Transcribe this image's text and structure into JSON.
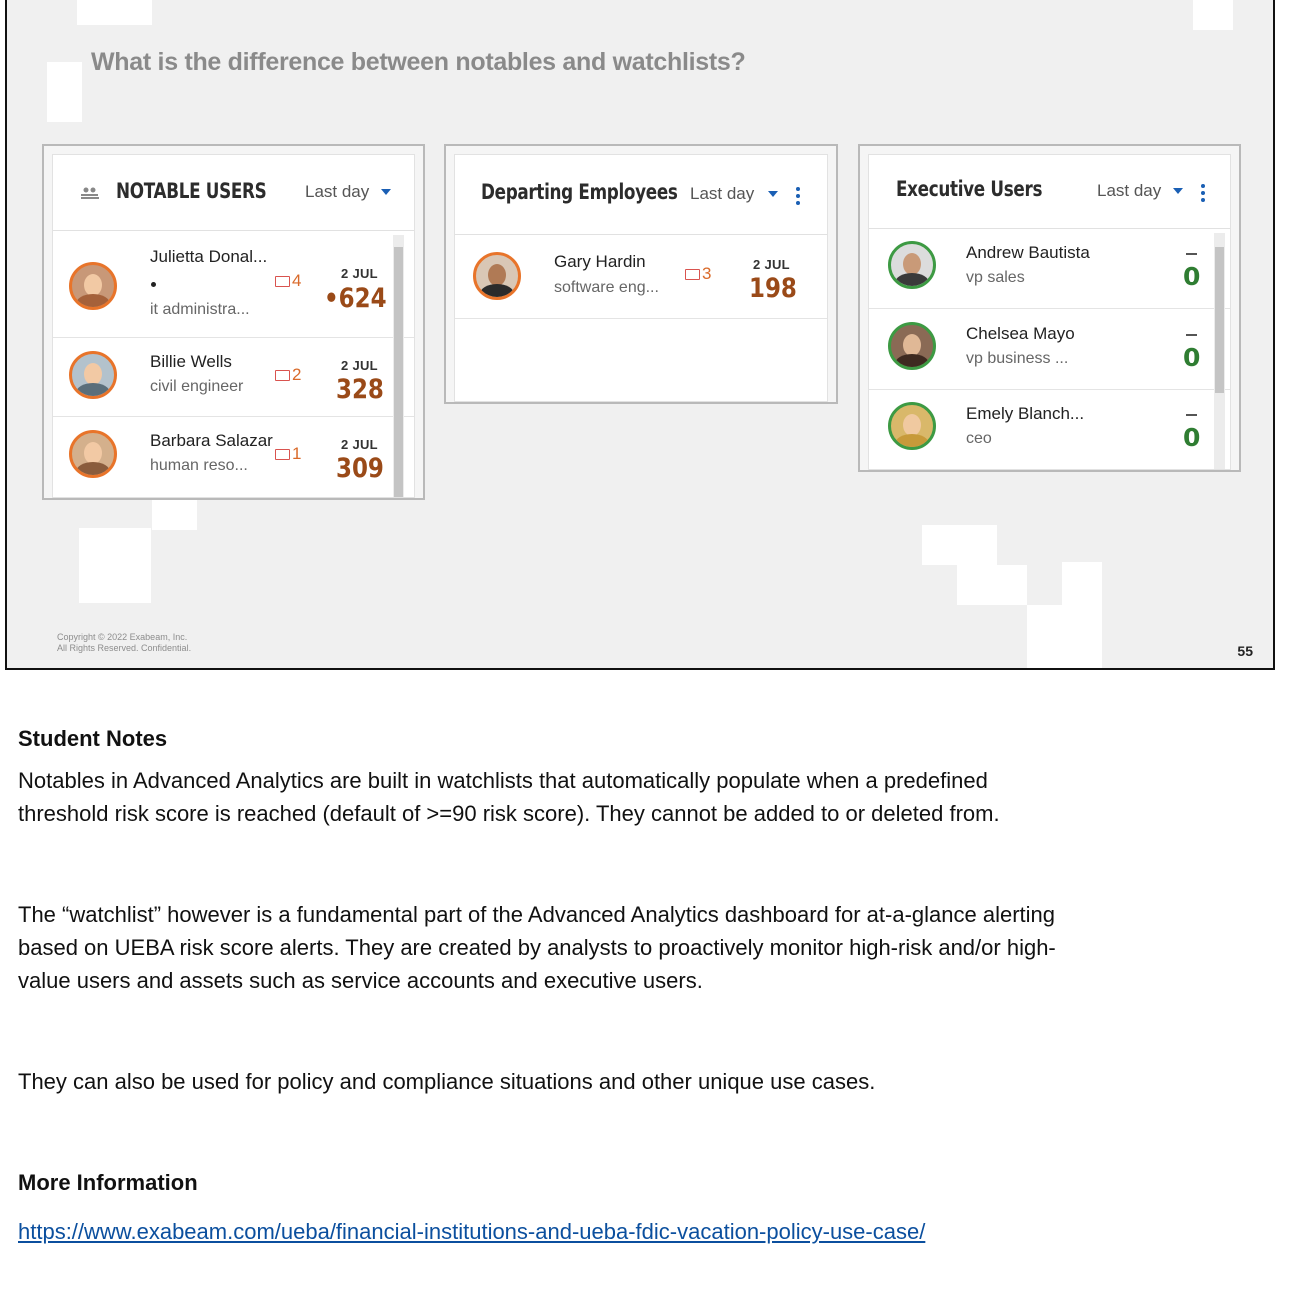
{
  "slide": {
    "title": "What is the difference between notables and watchlists?",
    "copyright_line1": "Copyright © 2022 Exabeam, Inc.",
    "copyright_line2": "All Rights Reserved. Confidential.",
    "page_number": "55"
  },
  "notable_users": {
    "title": "NOTABLE USERS",
    "range": "Last day",
    "rows": [
      {
        "name": "Julietta Donal...",
        "role": "it administra...",
        "count": "4",
        "date": "2 JUL",
        "score": "•624"
      },
      {
        "name": "Billie Wells",
        "role": "civil engineer",
        "count": "2",
        "date": "2 JUL",
        "score": "328"
      },
      {
        "name": "Barbara Salazar",
        "role": "human reso...",
        "count": "1",
        "date": "2 JUL",
        "score": "309"
      }
    ]
  },
  "departing": {
    "title": "Departing Employees",
    "range": "Last day",
    "rows": [
      {
        "name": "Gary Hardin",
        "role": "software eng...",
        "count": "3",
        "date": "2 JUL",
        "score": "198"
      }
    ]
  },
  "executive": {
    "title": "Executive Users",
    "range": "Last day",
    "rows": [
      {
        "name": "Andrew Bautista",
        "role": "vp sales",
        "score": "0"
      },
      {
        "name": "Chelsea Mayo",
        "role": "vp business ...",
        "score": "0"
      },
      {
        "name": "Emely Blanch...",
        "role": "ceo",
        "score": "0"
      }
    ]
  },
  "notes": {
    "heading": "Student Notes",
    "p1_l1": "Notables in Advanced Analytics are built in watchlists that automatically populate when a predefined",
    "p1_l2": "threshold risk score is reached (default of >=90 risk score).  They cannot be added to or deleted from.",
    "p2_l1": "The “watchlist” however is a fundamental part of the Advanced Analytics dashboard for at-a-glance alerting",
    "p2_l2": "based on UEBA risk score alerts. They are created by analysts to proactively monitor high-risk and/or high-",
    "p2_l3": "value users and assets such as service accounts and executive users.",
    "p3": "They can also be used for policy and compliance situations and other unique use cases.",
    "more_heading": "More Information",
    "link": "https://www.exabeam.com/ueba/financial-institutions-and-ueba-fdic-vacation-policy-use-case/"
  },
  "colors": {
    "score_orange": "#9a4a18",
    "score_green": "#2f7d32",
    "avatar_ring_orange": "#e8742a",
    "avatar_ring_green": "#3d9a43",
    "accent_blue": "#1a5fb4",
    "link_blue": "#0b4f9e"
  },
  "icons": {
    "notable": "people-icon",
    "count": "folder-icon",
    "range": "caret-down-icon",
    "menu": "kebab-menu-icon"
  }
}
